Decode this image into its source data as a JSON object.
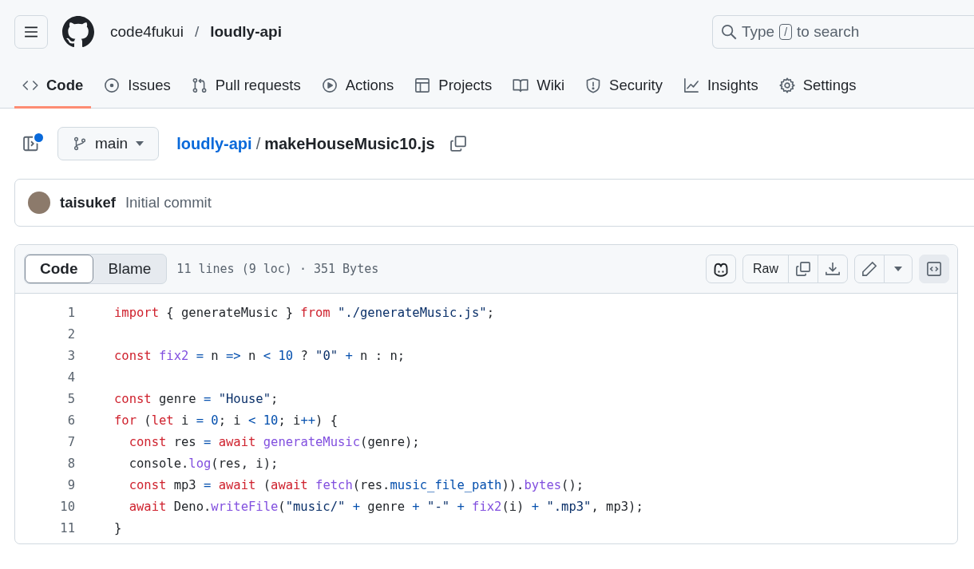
{
  "header": {
    "owner": "code4fukui",
    "separator": "/",
    "repo": "loudly-api",
    "search": {
      "placeholder_before": "Type",
      "key": "/",
      "placeholder_after": "to search"
    }
  },
  "tabs": [
    {
      "label": "Code",
      "selected": true
    },
    {
      "label": "Issues",
      "selected": false
    },
    {
      "label": "Pull requests",
      "selected": false
    },
    {
      "label": "Actions",
      "selected": false
    },
    {
      "label": "Projects",
      "selected": false
    },
    {
      "label": "Wiki",
      "selected": false
    },
    {
      "label": "Security",
      "selected": false
    },
    {
      "label": "Insights",
      "selected": false
    },
    {
      "label": "Settings",
      "selected": false
    }
  ],
  "file_nav": {
    "sidebar_notification": true,
    "branch": "main",
    "repo_link": "loudly-api",
    "separator": "/",
    "file_name": "makeHouseMusic10.js"
  },
  "commit": {
    "author": "taisukef",
    "message": "Initial commit"
  },
  "file_header": {
    "view_tabs": [
      {
        "label": "Code",
        "selected": true
      },
      {
        "label": "Blame",
        "selected": false
      }
    ],
    "info": "11 lines (9 loc) · 351 Bytes",
    "raw_button": "Raw"
  },
  "code_lines": [
    {
      "number": "1",
      "text": "import { generateMusic } from \"./generateMusic.js\";"
    },
    {
      "number": "2"
    },
    {
      "number": "3",
      "text": "const fix2 = n => n < 10 ? \"0\" + n : n;"
    },
    {
      "number": "4"
    },
    {
      "number": "5",
      "text": "const genre = \"House\";"
    },
    {
      "number": "6",
      "text": "for (let i = 0; i < 10; i++) {"
    },
    {
      "number": "7",
      "text": "  const res = await generateMusic(genre);"
    },
    {
      "number": "8",
      "text": "  console.log(res, i);"
    },
    {
      "number": "9",
      "text": "  const mp3 = await (await fetch(res.music_file_path)).bytes();"
    },
    {
      "number": "10",
      "text": "  await Deno.writeFile(\"music/\" + genre + \"-\" + fix2(i) + \".mp3\", mp3);"
    },
    {
      "number": "11",
      "text": "}"
    }
  ]
}
